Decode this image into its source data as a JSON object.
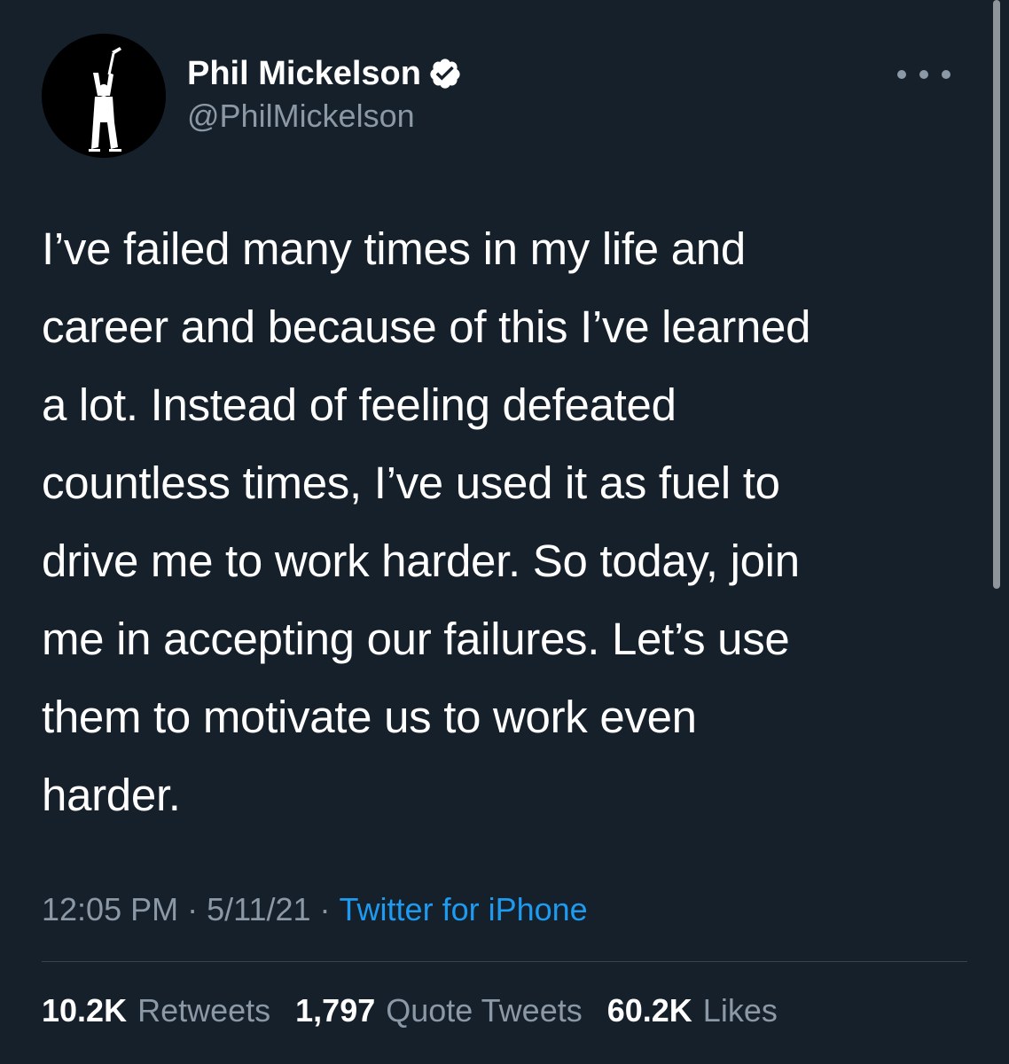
{
  "author": {
    "display_name": "Phil Mickelson",
    "handle": "@PhilMickelson",
    "verified": true,
    "avatar_icon": "golfer-silhouette-icon"
  },
  "tweet": {
    "lines": [
      "I’ve failed many times in my life and",
      "career and because of this I’ve learned",
      "a lot. Instead of feeling defeated",
      "countless times, I’ve used it as fuel to",
      "drive me to work harder. So today, join",
      "me in accepting our failures. Let’s use",
      "them to motivate us to work even",
      "harder."
    ]
  },
  "meta": {
    "time": "12:05 PM",
    "separator": "·",
    "date": "5/11/21",
    "source": "Twitter for iPhone"
  },
  "stats": {
    "retweets_count": "10.2K",
    "retweets_label": "Retweets",
    "quotes_count": "1,797",
    "quotes_label": "Quote Tweets",
    "likes_count": "60.2K",
    "likes_label": "Likes"
  },
  "colors": {
    "background": "#15202b",
    "primary_text": "#ffffff",
    "secondary_text": "#8b98a5",
    "link": "#1d9bf0",
    "divider": "#38444d"
  }
}
